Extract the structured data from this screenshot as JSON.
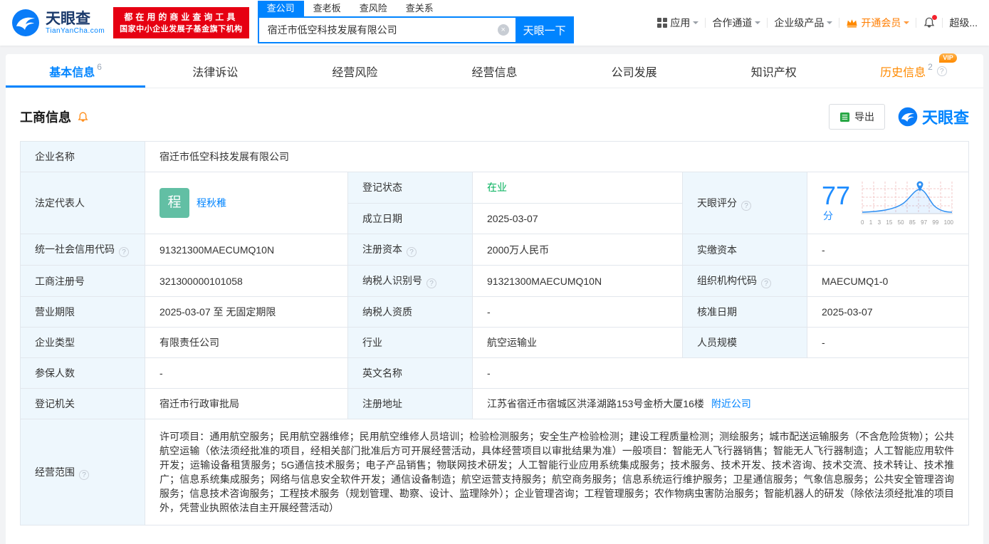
{
  "colors": {
    "accent_blue": "#0084ff",
    "banner_red": "#e60012",
    "vip_orange": "#ff8a00",
    "status_green": "#00b05a",
    "score_blue": "#1e8cff",
    "avatar_green": "#62bfa4"
  },
  "header": {
    "brand": "天眼查",
    "brand_domain": "TianYanCha.com",
    "banner_line1": "都在用的商业查询工具",
    "banner_line2": "国家中小企业发展子基金旗下机构",
    "search_tabs": [
      "查公司",
      "查老板",
      "查风险",
      "查关系"
    ],
    "search_value": "宿迁市低空科技发展有限公司",
    "search_button": "天眼一下",
    "menu": {
      "apps": "应用",
      "cooperation": "合作通道",
      "enterprise": "企业级产品",
      "vip": "开通会员",
      "super": "超级..."
    }
  },
  "tabbar": {
    "basic": "基本信息",
    "basic_badge": "6",
    "legal": "法律诉讼",
    "risk": "经营风险",
    "operation": "经营信息",
    "development": "公司发展",
    "ip": "知识产权",
    "history": "历史信息",
    "history_badge": "2",
    "history_vip": "VIP"
  },
  "section": {
    "title": "工商信息",
    "export_label": "导出",
    "brand_logo": "天眼查"
  },
  "fields": {
    "company_name": {
      "label": "企业名称",
      "value": "宿迁市低空科技发展有限公司"
    },
    "legal_rep": {
      "label": "法定代表人",
      "avatar_text": "程",
      "value": "程秋稚"
    },
    "reg_status": {
      "label": "登记状态",
      "value": "在业"
    },
    "est_date": {
      "label": "成立日期",
      "value": "2025-03-07"
    },
    "score": {
      "label": "天眼评分",
      "value": "77",
      "unit": "分",
      "ticks": [
        "0",
        "1",
        "3",
        "15",
        "50",
        "85",
        "97",
        "99",
        "100"
      ]
    },
    "credit_code": {
      "label": "统一社会信用代码",
      "value": "91321300MAECUMQ10N"
    },
    "reg_capital": {
      "label": "注册资本",
      "value": "2000万人民币"
    },
    "paid_capital": {
      "label": "实缴资本",
      "value": "-"
    },
    "reg_no": {
      "label": "工商注册号",
      "value": "321300000101058"
    },
    "taxpayer_no": {
      "label": "纳税人识别号",
      "value": "91321300MAECUMQ10N"
    },
    "org_code": {
      "label": "组织机构代码",
      "value": "MAECUMQ1-0"
    },
    "term": {
      "label": "营业期限",
      "value": "2025-03-07 至 无固定期限"
    },
    "taxpayer_quality": {
      "label": "纳税人资质",
      "value": "-"
    },
    "approved_date": {
      "label": "核准日期",
      "value": "2025-03-07"
    },
    "company_type": {
      "label": "企业类型",
      "value": "有限责任公司"
    },
    "industry": {
      "label": "行业",
      "value": "航空运输业"
    },
    "staff_size": {
      "label": "人员规模",
      "value": "-"
    },
    "insured_num": {
      "label": "参保人数",
      "value": "-"
    },
    "english_name": {
      "label": "英文名称",
      "value": "-"
    },
    "authority": {
      "label": "登记机关",
      "value": "宿迁市行政审批局"
    },
    "address": {
      "label": "注册地址",
      "value": "江苏省宿迁市宿城区洪泽湖路153号金桥大厦16楼",
      "nearby": "附近公司"
    },
    "scope": {
      "label": "经营范围",
      "value": "许可项目：通用航空服务；民用航空器维修；民用航空维修人员培训；检验检测服务；安全生产检验检测；建设工程质量检测；测绘服务；城市配送运输服务（不含危险货物）；公共航空运输（依法须经批准的项目，经相关部门批准后方可开展经营活动，具体经营项目以审批结果为准）一般项目：智能无人飞行器销售；智能无人飞行器制造；人工智能应用软件开发；运输设备租赁服务；5G通信技术服务；电子产品销售；物联网技术研发；人工智能行业应用系统集成服务；技术服务、技术开发、技术咨询、技术交流、技术转让、技术推广；信息系统集成服务；网络与信息安全软件开发；通信设备制造；航空运营支持服务；航空商务服务；信息系统运行维护服务；卫星通信服务；气象信息服务；公共安全管理咨询服务；信息技术咨询服务；工程技术服务（规划管理、勘察、设计、监理除外）；企业管理咨询；工程管理服务；农作物病虫害防治服务；智能机器人的研发（除依法须经批准的项目外，凭营业执照依法自主开展经营活动）"
    }
  }
}
